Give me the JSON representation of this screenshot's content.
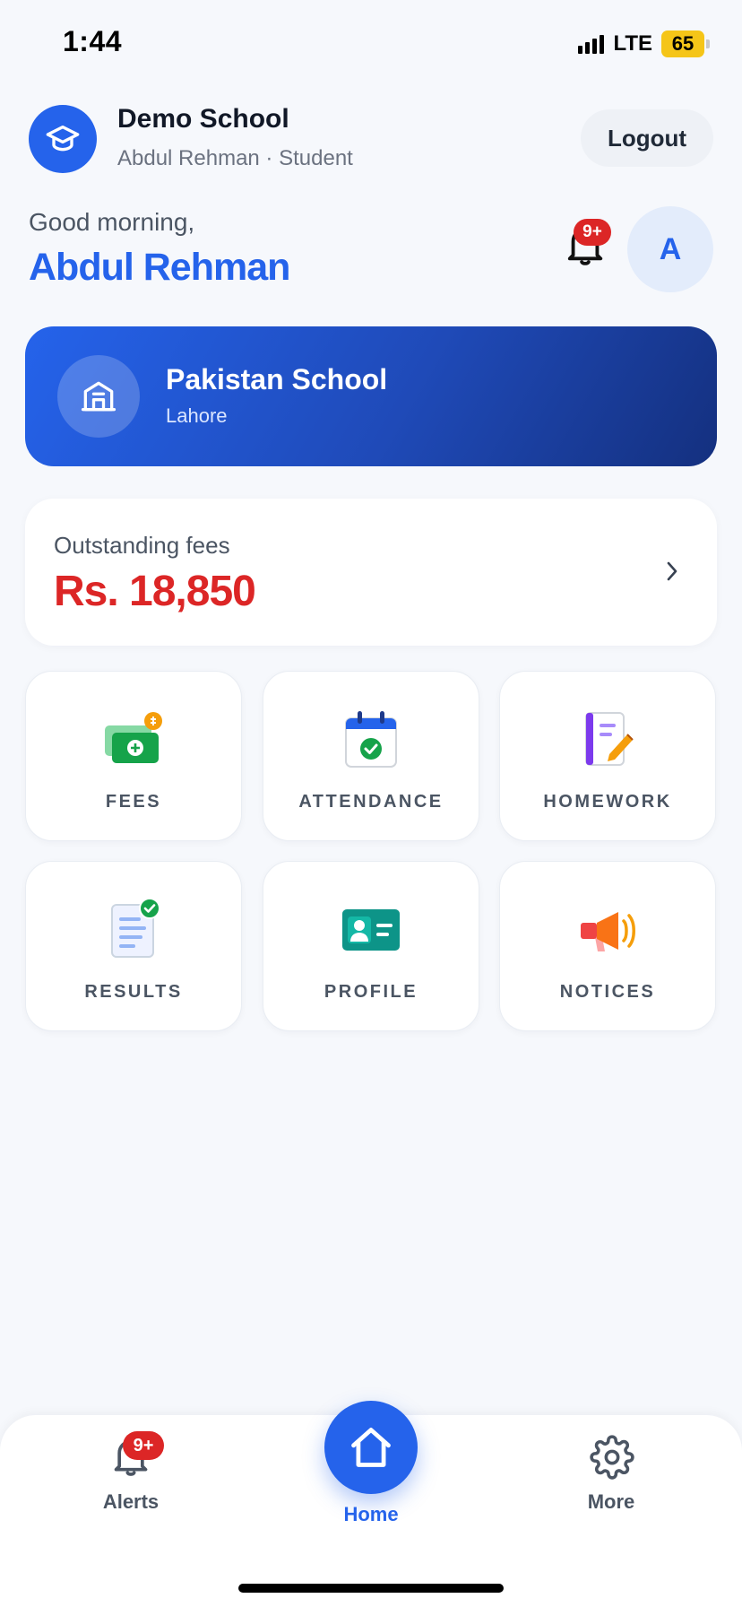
{
  "status_bar": {
    "time": "1:44",
    "network": "LTE",
    "battery_percent": "65",
    "signal_bars": 4
  },
  "header": {
    "school_name": "Demo School",
    "subtitle": "Abdul Rehman · Student",
    "logout_label": "Logout"
  },
  "greeting": {
    "salutation": "Good morning,",
    "name": "Abdul Rehman",
    "notification_badge": "9+",
    "avatar_initial": "A"
  },
  "school_card": {
    "name": "Pakistan School",
    "city": "Lahore"
  },
  "fees": {
    "label": "Outstanding fees",
    "amount": "Rs. 18,850"
  },
  "tiles": [
    {
      "label": "FEES",
      "icon": "money-icon"
    },
    {
      "label": "ATTENDANCE",
      "icon": "calendar-check-icon"
    },
    {
      "label": "HOMEWORK",
      "icon": "notebook-pencil-icon"
    },
    {
      "label": "RESULTS",
      "icon": "document-check-icon"
    },
    {
      "label": "PROFILE",
      "icon": "id-card-icon"
    },
    {
      "label": "NOTICES",
      "icon": "megaphone-icon"
    }
  ],
  "bottom_nav": {
    "alerts_label": "Alerts",
    "alerts_badge": "9+",
    "home_label": "Home",
    "more_label": "More"
  },
  "colors": {
    "primary": "#2563eb",
    "danger": "#dc2626",
    "background": "#f6f8fc",
    "battery": "#f5c518"
  }
}
